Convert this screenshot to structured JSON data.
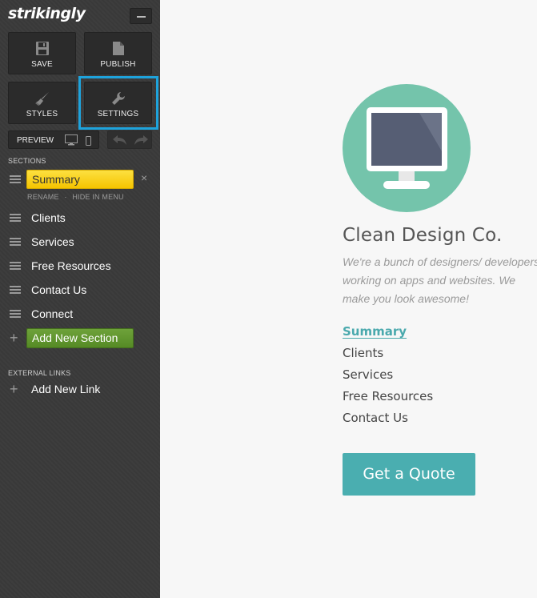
{
  "sidebar": {
    "logo": "strikingly",
    "toolbar": {
      "save_label": "SAVE",
      "publish_label": "PUBLISH",
      "styles_label": "STYLES",
      "settings_label": "SETTINGS",
      "preview_label": "PREVIEW"
    },
    "sections_heading": "SECTIONS",
    "active_section": {
      "label": "Summary",
      "rename_label": "RENAME",
      "separator": "·",
      "hide_label": "HIDE IN MENU"
    },
    "sections": [
      "Clients",
      "Services",
      "Free Resources",
      "Contact Us",
      "Connect"
    ],
    "add_section_label": "Add New Section",
    "external_links_heading": "EXTERNAL LINKS",
    "add_link_label": "Add New Link",
    "close_glyph": "×",
    "plus_glyph": "+"
  },
  "site": {
    "title": "Clean Design Co.",
    "tagline_lines": [
      "We're a bunch of designers/ developers",
      "working on apps and websites. We",
      "make you look awesome!"
    ],
    "nav": [
      "Summary",
      "Clients",
      "Services",
      "Free Resources",
      "Contact Us"
    ],
    "cta_label": "Get a Quote"
  },
  "colors": {
    "highlight": "#1ea3dc",
    "active_section": "#f5c400",
    "add_section": "#5f952d",
    "accent": "#4aaeb0",
    "hero_circle": "#74c4ab"
  },
  "icons": [
    "save-icon",
    "publish-icon",
    "styles-brush-icon",
    "settings-wrench-icon",
    "desktop-icon",
    "mobile-icon",
    "undo-icon",
    "redo-icon",
    "drag-handle-icon",
    "monitor-icon"
  ]
}
